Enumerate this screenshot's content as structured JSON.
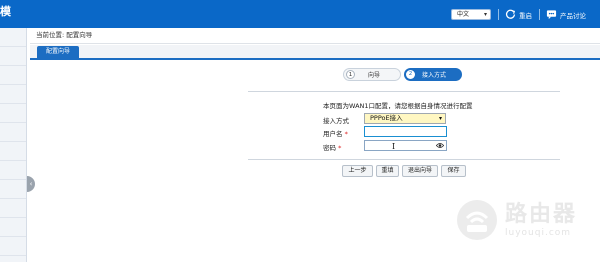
{
  "topbar": {
    "brand": "模",
    "language": "中文",
    "restart_label": "重启",
    "forum_label": "产品讨论"
  },
  "breadcrumb": "当前位置: 配置向导",
  "tabs": [
    {
      "label": "配置向导"
    }
  ],
  "steps": [
    {
      "num": "1",
      "label": "向导"
    },
    {
      "num": "2",
      "label": "接入方式"
    }
  ],
  "form": {
    "description": "本页面为WAN1口配置，请您根据自身情况进行配置",
    "access_mode_label": "接入方式",
    "access_mode_value": "PPPoE接入",
    "username_label": "用户名",
    "password_label": "密码",
    "required_mark": "*",
    "username_value": "",
    "password_value": ""
  },
  "buttons": {
    "prev": "上一步",
    "reset": "重填",
    "exit": "退出向导",
    "save": "保存"
  },
  "watermark": {
    "title": "路由器",
    "site": "luyouqi.com"
  },
  "colors": {
    "topbar": "#0a68c8",
    "accent": "#1c6dc2",
    "select_bg": "#fff7c2"
  }
}
